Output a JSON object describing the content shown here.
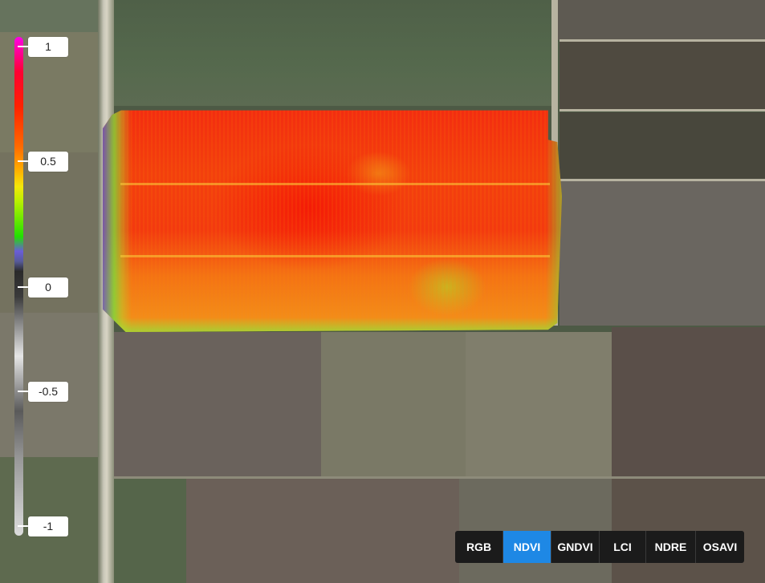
{
  "legend": {
    "labels": [
      "1",
      "0.5",
      "0",
      "-0.5",
      "-1"
    ]
  },
  "index_buttons": [
    {
      "label": "RGB",
      "active": false
    },
    {
      "label": "NDVI",
      "active": true
    },
    {
      "label": "GNDVI",
      "active": false
    },
    {
      "label": "LCI",
      "active": false
    },
    {
      "label": "NDRE",
      "active": false
    },
    {
      "label": "OSAVI",
      "active": false
    }
  ],
  "colors": {
    "active_button": "#1e88e5",
    "button_bar": "#1b1b1b"
  }
}
